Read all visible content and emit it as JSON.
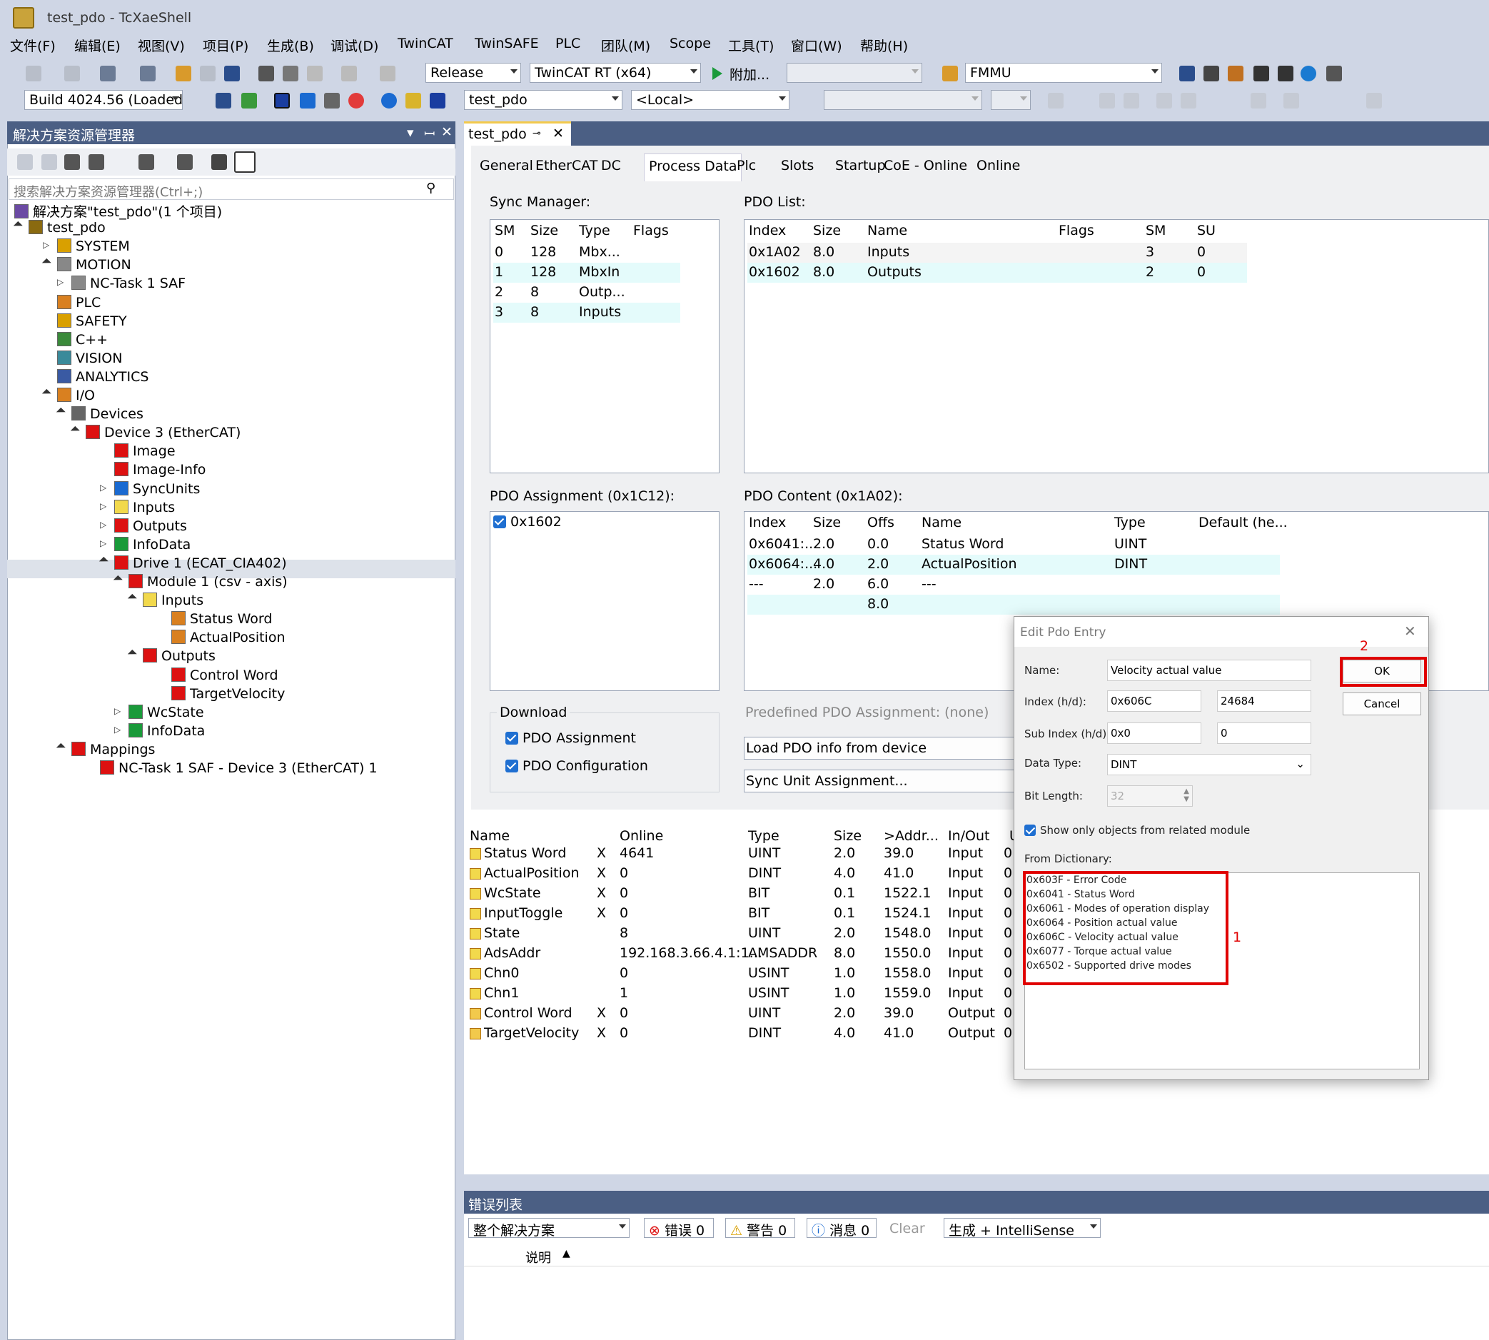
{
  "window": {
    "title": "test_pdo - TcXaeShell"
  },
  "menu": [
    "文件(F)",
    "编辑(E)",
    "视图(V)",
    "项目(P)",
    "生成(B)",
    "调试(D)",
    "TwinCAT",
    "TwinSAFE",
    "PLC",
    "团队(M)",
    "Scope",
    "工具(T)",
    "窗口(W)",
    "帮助(H)"
  ],
  "toolbar1": {
    "config": "Release",
    "platform": "TwinCAT RT (x64)",
    "attach": "附加...",
    "target": "FMMU"
  },
  "toolbar2": {
    "build": "Build 4024.56 (Loaded",
    "project": "test_pdo",
    "local": "<Local>"
  },
  "solution": {
    "panel_title": "解决方案资源管理器",
    "search_placeholder": "搜索解决方案资源管理器(Ctrl+;)",
    "items": [
      {
        "label": "解决方案\"test_pdo\"(1 个项目)"
      },
      {
        "label": "test_pdo"
      },
      {
        "label": "SYSTEM"
      },
      {
        "label": "MOTION"
      },
      {
        "label": "NC-Task 1 SAF"
      },
      {
        "label": "PLC"
      },
      {
        "label": "SAFETY"
      },
      {
        "label": "C++"
      },
      {
        "label": "VISION"
      },
      {
        "label": "ANALYTICS"
      },
      {
        "label": "I/O"
      },
      {
        "label": "Devices"
      },
      {
        "label": "Device 3 (EtherCAT)"
      },
      {
        "label": "Image"
      },
      {
        "label": "Image-Info"
      },
      {
        "label": "SyncUnits"
      },
      {
        "label": "Inputs"
      },
      {
        "label": "Outputs"
      },
      {
        "label": "InfoData"
      },
      {
        "label": "Drive 1 (ECAT_CIA402)"
      },
      {
        "label": "Module 1 (csv -  axis)"
      },
      {
        "label": "Inputs"
      },
      {
        "label": "Status Word"
      },
      {
        "label": "ActualPosition"
      },
      {
        "label": "Outputs"
      },
      {
        "label": "Control Word"
      },
      {
        "label": "TargetVelocity"
      },
      {
        "label": "WcState"
      },
      {
        "label": "InfoData"
      },
      {
        "label": "Mappings"
      },
      {
        "label": "NC-Task 1 SAF - Device 3 (EtherCAT) 1"
      }
    ]
  },
  "doc_tab": "test_pdo",
  "tabs": [
    "General",
    "EtherCAT",
    "DC",
    "Process Data",
    "Plc",
    "Slots",
    "Startup",
    "CoE - Online",
    "Online"
  ],
  "sync_manager": {
    "label": "Sync Manager:",
    "headers": [
      "SM",
      "Size",
      "Type",
      "Flags"
    ],
    "rows": [
      [
        "0",
        "128",
        "Mbx..."
      ],
      [
        "1",
        "128",
        "MbxIn"
      ],
      [
        "2",
        "8",
        "Outp..."
      ],
      [
        "3",
        "8",
        "Inputs"
      ]
    ]
  },
  "pdo_list": {
    "label": "PDO List:",
    "headers": [
      "Index",
      "Size",
      "Name",
      "Flags",
      "SM",
      "SU"
    ],
    "rows": [
      [
        "0x1A02",
        "8.0",
        "Inputs",
        "3",
        "0"
      ],
      [
        "0x1602",
        "8.0",
        "Outputs",
        "2",
        "0"
      ]
    ]
  },
  "pdo_assignment": {
    "label": "PDO Assignment (0x1C12):",
    "item": "0x1602"
  },
  "pdo_content": {
    "label": "PDO Content (0x1A02):",
    "headers": [
      "Index",
      "Size",
      "Offs",
      "Name",
      "Type",
      "Default (he..."
    ],
    "rows": [
      [
        "0x6041:...",
        "2.0",
        "0.0",
        "Status Word",
        "UINT"
      ],
      [
        "0x6064:...",
        "4.0",
        "2.0",
        "ActualPosition",
        "DINT"
      ],
      [
        "---",
        "2.0",
        "6.0",
        "---",
        ""
      ],
      [
        "",
        "",
        "8.0",
        "",
        ""
      ]
    ]
  },
  "download": {
    "label": "Download",
    "pdo_assignment": "PDO Assignment",
    "pdo_configuration": "PDO Configuration"
  },
  "predefined": "Predefined PDO Assignment: (none)",
  "load_pdo": "Load PDO info from device",
  "sync_unit": "Sync Unit Assignment...",
  "vars": {
    "headers": [
      "Name",
      "Online",
      "Type",
      "Size",
      ">Addr...",
      "In/Out",
      "U"
    ],
    "rows": [
      [
        "Status Word",
        "X",
        "4641",
        "UINT",
        "2.0",
        "39.0",
        "Input",
        "0"
      ],
      [
        "ActualPosition",
        "X",
        "0",
        "DINT",
        "4.0",
        "41.0",
        "Input",
        "0"
      ],
      [
        "WcState",
        "X",
        "0",
        "BIT",
        "0.1",
        "1522.1",
        "Input",
        "0"
      ],
      [
        "InputToggle",
        "X",
        "0",
        "BIT",
        "0.1",
        "1524.1",
        "Input",
        "0"
      ],
      [
        "State",
        "",
        "8",
        "UINT",
        "2.0",
        "1548.0",
        "Input",
        "0"
      ],
      [
        "AdsAddr",
        "",
        "192.168.3.66.4.1:1...",
        "AMSADDR",
        "8.0",
        "1550.0",
        "Input",
        "0"
      ],
      [
        "Chn0",
        "",
        "0",
        "USINT",
        "1.0",
        "1558.0",
        "Input",
        "0"
      ],
      [
        "Chn1",
        "",
        "1",
        "USINT",
        "1.0",
        "1559.0",
        "Input",
        "0"
      ],
      [
        "Control Word",
        "X",
        "0",
        "UINT",
        "2.0",
        "39.0",
        "Output",
        "0"
      ],
      [
        "TargetVelocity",
        "X",
        "0",
        "DINT",
        "4.0",
        "41.0",
        "Output",
        "0"
      ]
    ]
  },
  "dialog": {
    "title": "Edit Pdo Entry",
    "name_label": "Name:",
    "name": "Velocity actual value",
    "index_label": "Index (h/d):",
    "index_hex": "0x606C",
    "index_dec": "24684",
    "sub_label": "Sub Index (h/d):",
    "sub_hex": "0x0",
    "sub_dec": "0",
    "type_label": "Data Type:",
    "type": "DINT",
    "bitlen_label": "Bit Length:",
    "bitlen": "32",
    "show_only": "Show only objects from related module",
    "from_dict": "From Dictionary:",
    "ok": "OK",
    "cancel": "Cancel",
    "annot1": "1",
    "annot2": "2",
    "dict": [
      "0x603F - Error Code",
      "0x6041 - Status Word",
      "0x6061 - Modes of operation display",
      "0x6064 - Position actual value",
      "0x606C - Velocity actual value",
      "0x6077 - Torque actual value",
      "0x6502 - Supported drive modes"
    ]
  },
  "errors": {
    "title": "错误列表",
    "scope": "整个解决方案",
    "err": "错误 0",
    "warn": "警告 0",
    "msg": "消息 0",
    "clear": "Clear",
    "build": "生成 + IntelliSense",
    "col": "说明"
  }
}
